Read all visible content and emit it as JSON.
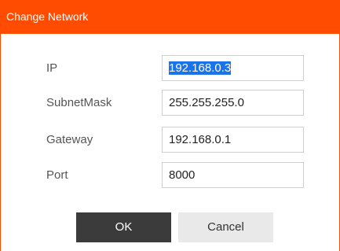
{
  "window": {
    "title": "Change Network"
  },
  "form": {
    "ip_label": "IP",
    "ip_value": "192.168.0.3",
    "subnet_label": "SubnetMask",
    "subnet_value": "255.255.255.0",
    "gateway_label": "Gateway",
    "gateway_value": "192.168.0.1",
    "port_label": "Port",
    "port_value": "8000"
  },
  "buttons": {
    "ok_label": "OK",
    "cancel_label": "Cancel"
  },
  "colors": {
    "titlebar": "#ff4c00",
    "ok_button": "#3b3b3b",
    "cancel_button": "#e9e9e9",
    "selection": "#1a73e8"
  }
}
